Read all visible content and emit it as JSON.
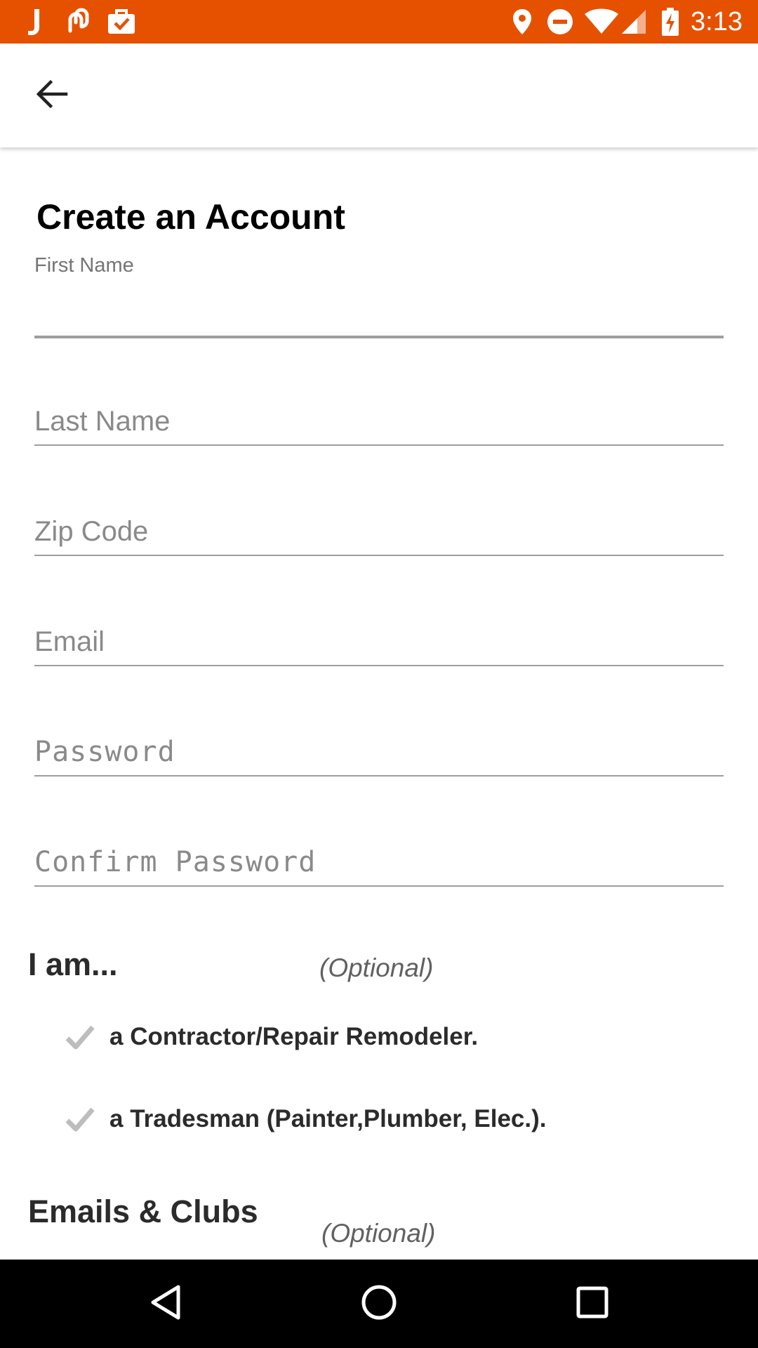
{
  "status_bar": {
    "time": "3:13",
    "background_color": "#e65100",
    "left_icons": [
      "j-app-icon",
      "link-app-icon",
      "briefcase-check-icon"
    ],
    "right_icons": [
      "location-pin-icon",
      "do-not-disturb-icon",
      "wifi-icon",
      "cell-signal-icon",
      "battery-charging-icon"
    ]
  },
  "app_bar": {
    "back_icon": "arrow-back-icon"
  },
  "form": {
    "title": "Create an Account",
    "first_name": {
      "label": "First Name",
      "value": ""
    },
    "last_name": {
      "placeholder": "Last Name",
      "value": ""
    },
    "zip_code": {
      "placeholder": "Zip Code",
      "value": ""
    },
    "email": {
      "placeholder": "Email",
      "value": ""
    },
    "password": {
      "placeholder": "Password",
      "value": ""
    },
    "confirm_password": {
      "placeholder": "Confirm Password",
      "value": ""
    }
  },
  "i_am": {
    "heading": "I am...",
    "optional": "(Optional)",
    "options": [
      {
        "label": "a Contractor/Repair Remodeler.",
        "checked": false
      },
      {
        "label": "a Tradesman (Painter,Plumber, Elec.).",
        "checked": false
      }
    ]
  },
  "emails_clubs": {
    "heading": "Emails & Clubs",
    "optional": "(Optional)"
  },
  "nav_bar": {
    "buttons": [
      "back-triangle-icon",
      "home-circle-icon",
      "recents-square-icon"
    ]
  }
}
